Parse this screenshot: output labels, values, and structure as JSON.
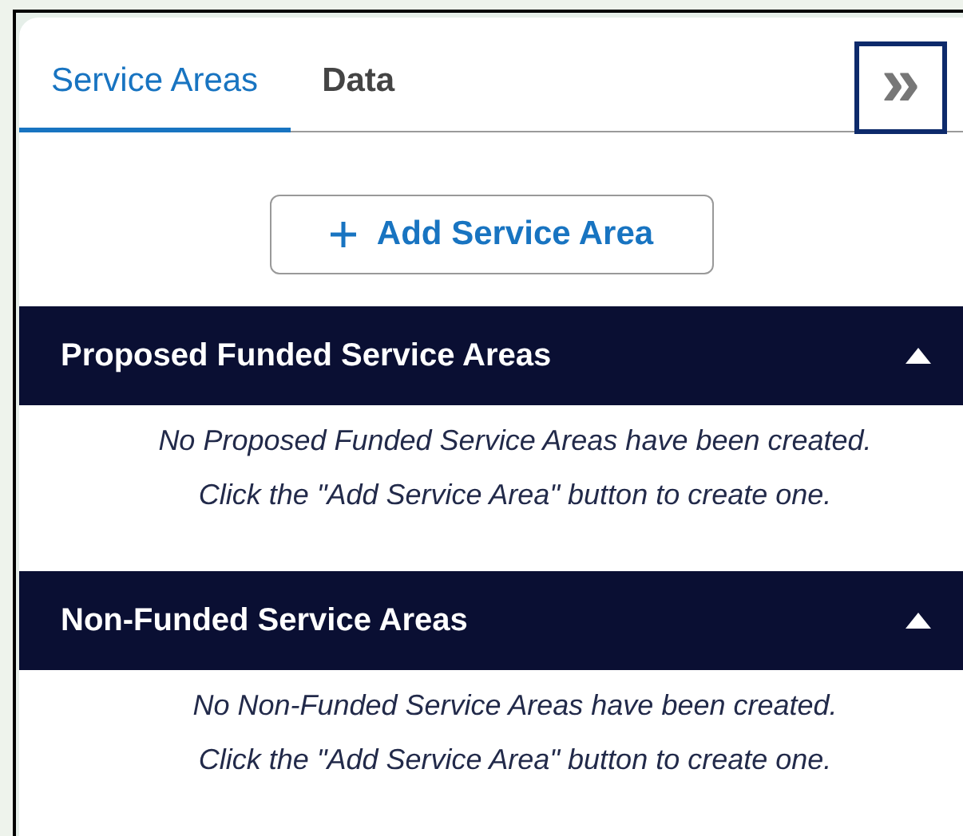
{
  "tabs": [
    {
      "label": "Service Areas",
      "selected": true
    },
    {
      "label": "Data",
      "selected": false
    }
  ],
  "collapse_button": {
    "label": "»"
  },
  "add_button": {
    "label": "Add Service Area"
  },
  "sections": [
    {
      "title": "Proposed Funded Service Areas",
      "expanded": true,
      "message": [
        "No Proposed Funded Service Areas have been created.",
        "Click the \"Add Service Area\" button to create one."
      ]
    },
    {
      "title": "Non-Funded Service Areas",
      "expanded": true,
      "message": [
        "No Non-Funded Service Areas have been created.",
        "Click the \"Add Service Area\" button to create one."
      ]
    }
  ]
}
